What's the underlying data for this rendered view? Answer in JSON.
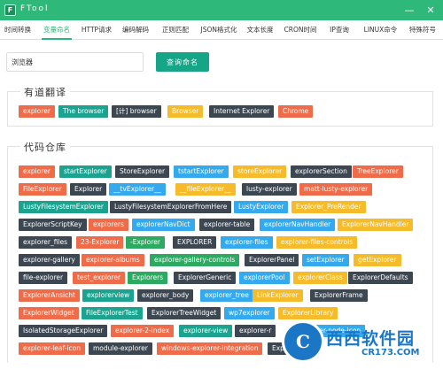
{
  "window": {
    "title": "FTool",
    "minimize_label": "—",
    "close_label": "✕"
  },
  "tabs": [
    {
      "label": "时间转换"
    },
    {
      "label": "变量命名",
      "active": true
    },
    {
      "label": "HTTP请求"
    },
    {
      "label": "编码解码"
    },
    {
      "label": "正则匹配"
    },
    {
      "label": "JSON格式化"
    },
    {
      "label": "文本长度"
    },
    {
      "label": "CRON时间"
    },
    {
      "label": "IP查询"
    },
    {
      "label": "LINUX命令"
    },
    {
      "label": "特殊符号"
    }
  ],
  "search": {
    "value": "浏览器",
    "button_label": "查询命名"
  },
  "youdao": {
    "title": "有道翻译",
    "results": [
      {
        "text": "explorer",
        "color": "#ef6c4a"
      },
      {
        "text": "The browser",
        "color": "#1ba38f"
      },
      {
        "text": "[计] browser",
        "color": "#3d4752"
      },
      {
        "text": "Browser",
        "color": "#f6bb2b"
      },
      {
        "text": "Internet Explorer",
        "color": "#3d4752"
      },
      {
        "text": "Chrome",
        "color": "#ef6c4a"
      }
    ]
  },
  "code": {
    "title": "代码仓库",
    "rows": [
      [
        "explorer",
        "startExplorer",
        "StoreExplorer",
        "tstartExplorer",
        "storeExplorer",
        "explorerSection",
        "TreeExplorer"
      ],
      [
        "FileExplorer",
        "Explorer",
        "__tvExplorer__",
        "__fileExplorer__",
        "lusty-explorer",
        "matt-lusty-explorer"
      ],
      [
        "LustyFilesystemExplorer",
        "LustyFilesystemExplorerFromHere",
        "LustyExplorer",
        "Explorer_PreRender"
      ],
      [
        "ExplorerScriptKey",
        "explorers",
        "explorerNavDict",
        "explorer-table",
        "explorerNavHandler",
        "ExplorerNavHandler"
      ],
      [
        "explorer_files",
        "23-Explorer",
        "-Explorer",
        "EXPLORER",
        "explorer-files",
        "explorer-files-controls"
      ],
      [
        "explorer-gallery",
        "explorer-albums",
        "explorer-gallery-controls",
        "ExplorerPanel",
        "setExplorer",
        "getExplorer"
      ],
      [
        "file-explorer",
        "test_explorer",
        "Explorers",
        "ExplorerGeneric",
        "explorerPool",
        "explorerClass",
        "ExplorerDefaults"
      ],
      [
        "ExplorerAnsicht",
        "explorerview",
        "explorer_body",
        "explorer_tree",
        "LinkExplorer",
        "ExplorerFrame"
      ],
      [
        "ExplorerWidget",
        "FileExplorerTest",
        "ExplorerTreeWidget",
        "wp7explorer",
        "ExplorerLibrary"
      ],
      [
        "IsolatedStorageExplorer",
        "explorer-2-index",
        "explorer-view",
        "explorer-r",
        "explorer-node-icon"
      ],
      [
        "explorer-leaf-icon",
        "module-explorer",
        "windows-explorer-integration",
        "Explorer"
      ]
    ]
  },
  "watermark": {
    "logo": "C",
    "name": "西西软件园",
    "url": "CR173.COM"
  },
  "colors": {
    "accent": "#2eb87a",
    "button": "#17a588",
    "tag_orange": "#ef6c4a",
    "tag_teal": "#1ba38f",
    "tag_dark": "#3d4752",
    "tag_yellow": "#f6bb2b",
    "tag_blue": "#34a9ee",
    "tag_green": "#2ea962"
  }
}
